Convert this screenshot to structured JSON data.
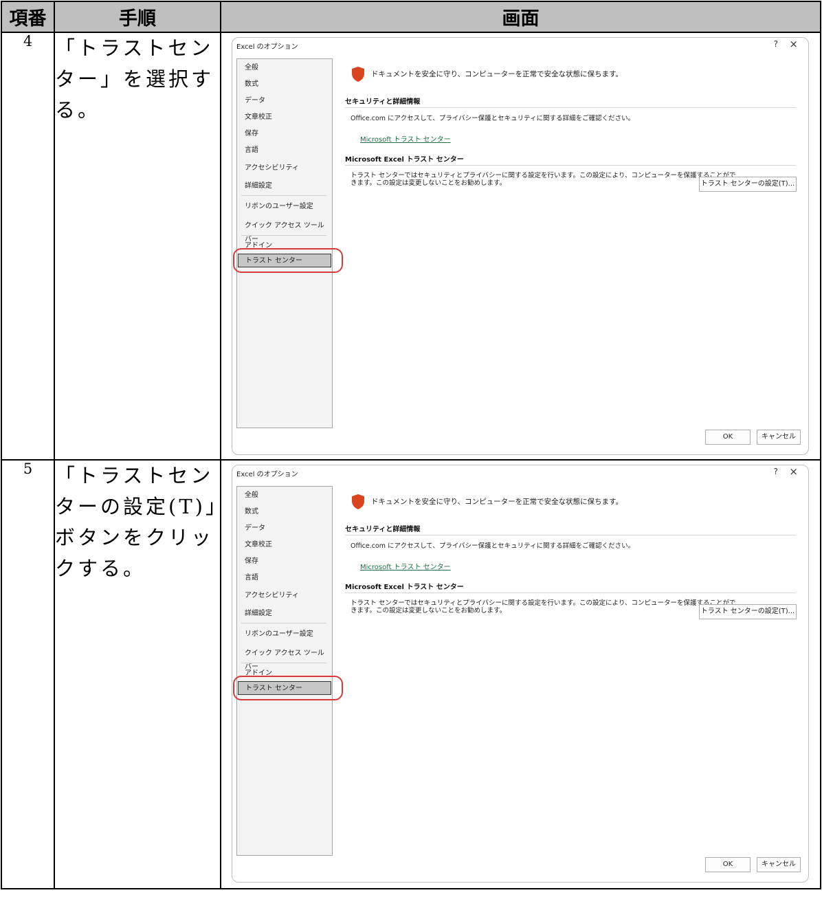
{
  "headers": {
    "no": "項番",
    "step": "手順",
    "screen": "画面"
  },
  "rows": [
    {
      "no": "4",
      "step": "「トラストセンター」を選択する。"
    },
    {
      "no": "5",
      "step": "「トラストセンターの設定(T)」ボタンをクリックする。"
    }
  ],
  "dialog": {
    "title": "Excel のオプション",
    "help": "?",
    "close": "×",
    "nav": [
      "全般",
      "数式",
      "データ",
      "文章校正",
      "保存",
      "言語",
      "アクセシビリティ",
      "詳細設定",
      "リボンのユーザー設定",
      "クイック アクセス ツール バー",
      "アドイン",
      "トラスト センター"
    ],
    "selected": "トラスト センター",
    "intro": "ドキュメントを安全に守り、コンピューターを正常で安全な状態に保ちます。",
    "security_heading": "セキュリティと詳細情報",
    "security_desc": "Office.com にアクセスして、プライバシー保護とセキュリティに関する詳細をご確認ください。",
    "ms_link": "Microsoft トラスト センター",
    "trust_heading": "Microsoft Excel トラスト センター",
    "trust_desc_1": "トラスト センターではセキュリティとプライバシーに関する設定を行います。この設定により、コンピューターを保護することがで",
    "trust_desc_2": "きます。この設定は変更しないことをお勧めします。",
    "trust_button": "トラスト センターの設定(T)...",
    "ok": "OK",
    "cancel": "キャンセル"
  },
  "colors": {
    "accent_link": "#1f6e43",
    "shield": "#d9451e",
    "highlight": "#d63a3a",
    "header_bg": "#bfbfbf"
  }
}
